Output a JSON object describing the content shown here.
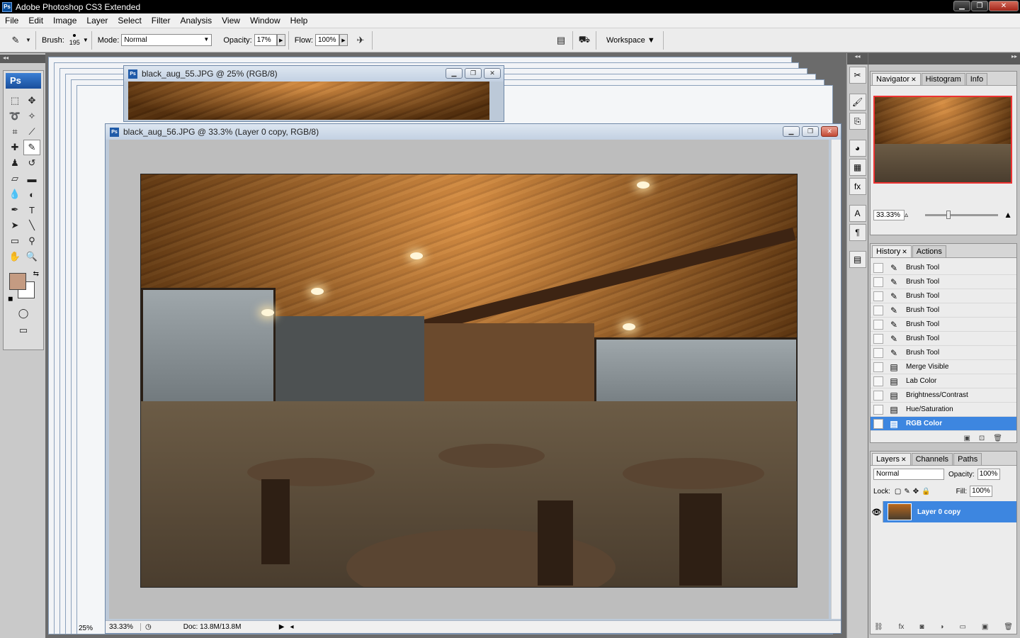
{
  "app": {
    "title": "Adobe Photoshop CS3 Extended"
  },
  "window_controls": {
    "minimize": "▁",
    "restore": "❐",
    "close": "✕"
  },
  "menu": [
    "File",
    "Edit",
    "Image",
    "Layer",
    "Select",
    "Filter",
    "Analysis",
    "View",
    "Window",
    "Help"
  ],
  "options": {
    "brush_label": "Brush:",
    "brush_size": "195",
    "mode_label": "Mode:",
    "mode_value": "Normal",
    "opacity_label": "Opacity:",
    "opacity_value": "17%",
    "flow_label": "Flow:",
    "flow_value": "100%",
    "workspace_label": "Workspace ▼"
  },
  "toolbox": {
    "logo": "Ps"
  },
  "documents": {
    "back": {
      "title": "black_aug_55.JPG @ 25% (RGB/8)",
      "zoom": "25%"
    },
    "front": {
      "title": "black_aug_56.JPG @ 33.3% (Layer 0 copy, RGB/8)",
      "zoom": "33.33%",
      "doc_size": "Doc: 13.8M/13.8M"
    }
  },
  "navigator": {
    "tabs": [
      "Navigator",
      "Histogram",
      "Info"
    ],
    "zoom": "33.33%"
  },
  "history": {
    "tabs": [
      "History",
      "Actions"
    ],
    "items": [
      "Brush Tool",
      "Brush Tool",
      "Brush Tool",
      "Brush Tool",
      "Brush Tool",
      "Brush Tool",
      "Brush Tool",
      "Merge Visible",
      "Lab Color",
      "Brightness/Contrast",
      "Hue/Saturation",
      "RGB Color"
    ]
  },
  "layers": {
    "tabs": [
      "Layers",
      "Channels",
      "Paths"
    ],
    "blend_mode": "Normal",
    "opacity_label": "Opacity:",
    "opacity": "100%",
    "lock_label": "Lock:",
    "fill_label": "Fill:",
    "fill": "100%",
    "layer_name": "Layer 0 copy"
  },
  "colors": {
    "foreground": "#c49b82",
    "background": "#ffffff",
    "accent": "#3d86e0"
  }
}
